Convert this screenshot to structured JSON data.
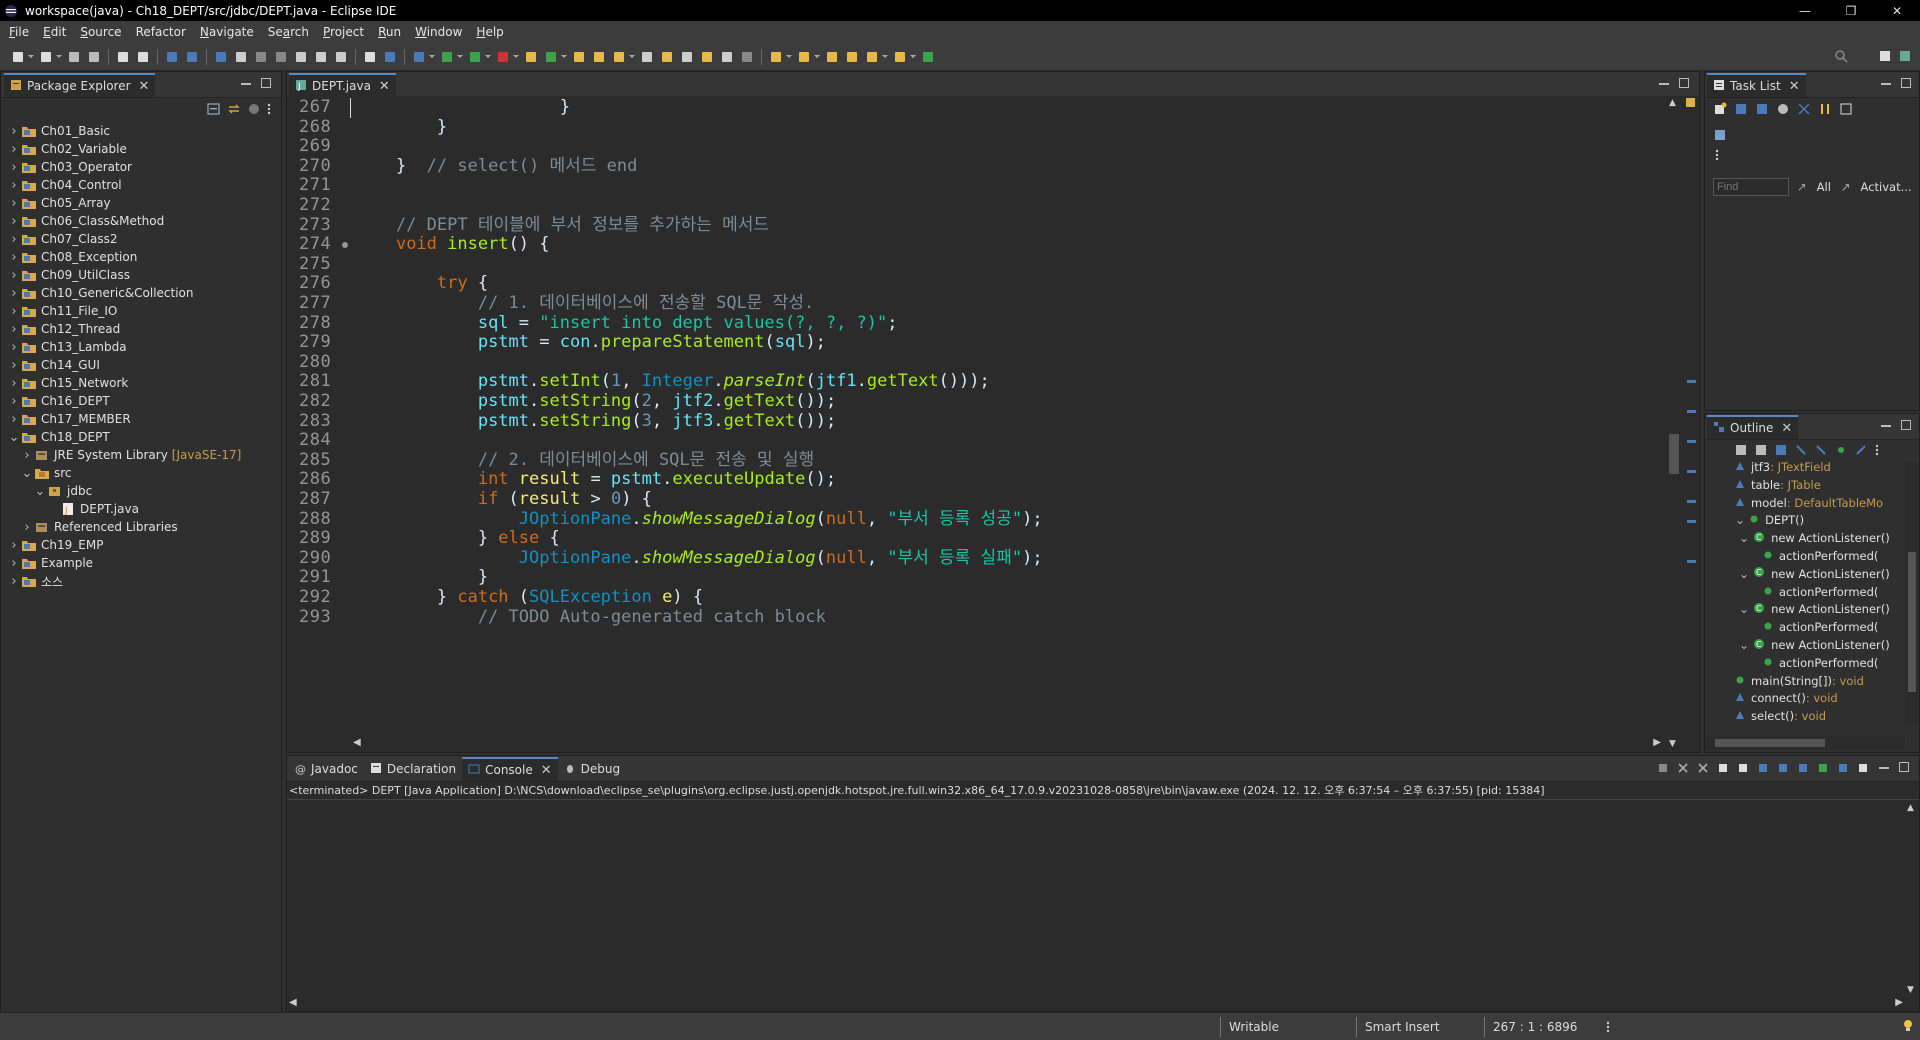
{
  "window": {
    "title": "workspace(java) - Ch18_DEPT/src/jdbc/DEPT.java - Eclipse IDE"
  },
  "menu": [
    "File",
    "Edit",
    "Source",
    "Refactor",
    "Navigate",
    "Search",
    "Project",
    "Run",
    "Window",
    "Help"
  ],
  "menu_mnemonic": [
    "F",
    "E",
    "S",
    "",
    "N",
    "a",
    "P",
    "R",
    "W",
    "H"
  ],
  "package_explorer": {
    "title": "Package Explorer",
    "items": [
      {
        "label": "Ch01_Basic",
        "level": 0,
        "expanded": false,
        "kind": "project"
      },
      {
        "label": "Ch02_Variable",
        "level": 0,
        "expanded": false,
        "kind": "project"
      },
      {
        "label": "Ch03_Operator",
        "level": 0,
        "expanded": false,
        "kind": "project"
      },
      {
        "label": "Ch04_Control",
        "level": 0,
        "expanded": false,
        "kind": "project"
      },
      {
        "label": "Ch05_Array",
        "level": 0,
        "expanded": false,
        "kind": "project"
      },
      {
        "label": "Ch06_Class&Method",
        "level": 0,
        "expanded": false,
        "kind": "project"
      },
      {
        "label": "Ch07_Class2",
        "level": 0,
        "expanded": false,
        "kind": "project"
      },
      {
        "label": "Ch08_Exception",
        "level": 0,
        "expanded": false,
        "kind": "project"
      },
      {
        "label": "Ch09_UtilClass",
        "level": 0,
        "expanded": false,
        "kind": "project"
      },
      {
        "label": "Ch10_Generic&Collection",
        "level": 0,
        "expanded": false,
        "kind": "project"
      },
      {
        "label": "Ch11_File_IO",
        "level": 0,
        "expanded": false,
        "kind": "project"
      },
      {
        "label": "Ch12_Thread",
        "level": 0,
        "expanded": false,
        "kind": "project"
      },
      {
        "label": "Ch13_Lambda",
        "level": 0,
        "expanded": false,
        "kind": "project"
      },
      {
        "label": "Ch14_GUI",
        "level": 0,
        "expanded": false,
        "kind": "project"
      },
      {
        "label": "Ch15_Network",
        "level": 0,
        "expanded": false,
        "kind": "project"
      },
      {
        "label": "Ch16_DEPT",
        "level": 0,
        "expanded": false,
        "kind": "project"
      },
      {
        "label": "Ch17_MEMBER",
        "level": 0,
        "expanded": false,
        "kind": "project"
      },
      {
        "label": "Ch18_DEPT",
        "level": 0,
        "expanded": true,
        "kind": "project"
      },
      {
        "label": "JRE System Library",
        "decoration": "[JavaSE-17]",
        "level": 1,
        "expanded": false,
        "kind": "library"
      },
      {
        "label": "src",
        "level": 1,
        "expanded": true,
        "kind": "srcfolder"
      },
      {
        "label": "jdbc",
        "level": 2,
        "expanded": true,
        "kind": "package"
      },
      {
        "label": "DEPT.java",
        "level": 3,
        "expanded": false,
        "kind": "javafile"
      },
      {
        "label": "Referenced Libraries",
        "level": 1,
        "expanded": false,
        "kind": "library"
      },
      {
        "label": "Ch19_EMP",
        "level": 0,
        "expanded": false,
        "kind": "project"
      },
      {
        "label": "Example",
        "level": 0,
        "expanded": false,
        "kind": "project"
      },
      {
        "label": "소스",
        "level": 0,
        "expanded": false,
        "kind": "project"
      }
    ]
  },
  "editor": {
    "tab": "DEPT.java",
    "lines": [
      {
        "n": "267",
        "code": [
          [
            "pl",
            "                    }"
          ]
        ]
      },
      {
        "n": "268",
        "code": [
          [
            "pl",
            "        }"
          ]
        ]
      },
      {
        "n": "269",
        "code": [
          [
            "pl",
            ""
          ]
        ]
      },
      {
        "n": "270",
        "code": [
          [
            "pl",
            "    }  "
          ],
          [
            "cm",
            "// select() 메서드 end"
          ]
        ]
      },
      {
        "n": "271",
        "code": [
          [
            "pl",
            ""
          ]
        ]
      },
      {
        "n": "272",
        "code": [
          [
            "pl",
            ""
          ]
        ]
      },
      {
        "n": "273",
        "code": [
          [
            "pl",
            "    "
          ],
          [
            "cm",
            "// DEPT 테이블에 부서 정보를 추가하는 메서드"
          ]
        ]
      },
      {
        "n": "274",
        "code": [
          [
            "pl",
            "    "
          ],
          [
            "kw",
            "void "
          ],
          [
            "mt",
            "insert"
          ],
          [
            "pl",
            "() {"
          ]
        ]
      },
      {
        "n": "275",
        "code": [
          [
            "pl",
            ""
          ]
        ]
      },
      {
        "n": "276",
        "code": [
          [
            "pl",
            "        "
          ],
          [
            "kw",
            "try "
          ],
          [
            "pl",
            "{"
          ]
        ]
      },
      {
        "n": "277",
        "code": [
          [
            "pl",
            "            "
          ],
          [
            "cm",
            "// 1. 데이터베이스에 전송할 SQL문 작성."
          ]
        ]
      },
      {
        "n": "278",
        "code": [
          [
            "pl",
            "            "
          ],
          [
            "vr",
            "sql "
          ],
          [
            "pl",
            "= "
          ],
          [
            "st",
            "\"insert into dept values(?, ?, ?)\""
          ],
          [
            "pl",
            ";"
          ]
        ]
      },
      {
        "n": "279",
        "code": [
          [
            "pl",
            "            "
          ],
          [
            "vr",
            "pstmt "
          ],
          [
            "pl",
            "= "
          ],
          [
            "vr",
            "con"
          ],
          [
            "pl",
            "."
          ],
          [
            "mt",
            "prepareStatement"
          ],
          [
            "pl",
            "("
          ],
          [
            "vr",
            "sql"
          ],
          [
            "pl",
            ");"
          ]
        ]
      },
      {
        "n": "280",
        "code": [
          [
            "pl",
            ""
          ]
        ]
      },
      {
        "n": "281",
        "code": [
          [
            "pl",
            "            "
          ],
          [
            "vr",
            "pstmt"
          ],
          [
            "pl",
            "."
          ],
          [
            "mt",
            "setInt"
          ],
          [
            "pl",
            "("
          ],
          [
            "nm",
            "1"
          ],
          [
            "pl",
            ", "
          ],
          [
            "cl",
            "Integer"
          ],
          [
            "pl",
            "."
          ],
          [
            "it",
            "parseInt"
          ],
          [
            "pl",
            "("
          ],
          [
            "vr",
            "jtf1"
          ],
          [
            "pl",
            "."
          ],
          [
            "mt",
            "getText"
          ],
          [
            "pl",
            "()));"
          ]
        ]
      },
      {
        "n": "282",
        "code": [
          [
            "pl",
            "            "
          ],
          [
            "vr",
            "pstmt"
          ],
          [
            "pl",
            "."
          ],
          [
            "mt",
            "setString"
          ],
          [
            "pl",
            "("
          ],
          [
            "nm",
            "2"
          ],
          [
            "pl",
            ", "
          ],
          [
            "vr",
            "jtf2"
          ],
          [
            "pl",
            "."
          ],
          [
            "mt",
            "getText"
          ],
          [
            "pl",
            "());"
          ]
        ]
      },
      {
        "n": "283",
        "code": [
          [
            "pl",
            "            "
          ],
          [
            "vr",
            "pstmt"
          ],
          [
            "pl",
            "."
          ],
          [
            "mt",
            "setString"
          ],
          [
            "pl",
            "("
          ],
          [
            "nm",
            "3"
          ],
          [
            "pl",
            ", "
          ],
          [
            "vr",
            "jtf3"
          ],
          [
            "pl",
            "."
          ],
          [
            "mt",
            "getText"
          ],
          [
            "pl",
            "());"
          ]
        ]
      },
      {
        "n": "284",
        "code": [
          [
            "pl",
            ""
          ]
        ]
      },
      {
        "n": "285",
        "code": [
          [
            "pl",
            "            "
          ],
          [
            "cm",
            "// 2. 데이터베이스에 SQL문 전송 및 실행"
          ]
        ]
      },
      {
        "n": "286",
        "code": [
          [
            "pl",
            "            "
          ],
          [
            "kw",
            "int "
          ],
          [
            "ov",
            "result "
          ],
          [
            "pl",
            "= "
          ],
          [
            "vr",
            "pstmt"
          ],
          [
            "pl",
            "."
          ],
          [
            "mt",
            "executeUpdate"
          ],
          [
            "pl",
            "();"
          ]
        ]
      },
      {
        "n": "287",
        "code": [
          [
            "pl",
            "            "
          ],
          [
            "kw",
            "if "
          ],
          [
            "pl",
            "("
          ],
          [
            "ov",
            "result "
          ],
          [
            "pl",
            "> "
          ],
          [
            "nm",
            "0"
          ],
          [
            "pl",
            ") {"
          ]
        ]
      },
      {
        "n": "288",
        "code": [
          [
            "pl",
            "                "
          ],
          [
            "cl",
            "JOptionPane"
          ],
          [
            "pl",
            "."
          ],
          [
            "it",
            "showMessageDialog"
          ],
          [
            "pl",
            "("
          ],
          [
            "kw",
            "null"
          ],
          [
            "pl",
            ", "
          ],
          [
            "st",
            "\"부서 등록 성공\""
          ],
          [
            "pl",
            ");"
          ]
        ]
      },
      {
        "n": "289",
        "code": [
          [
            "pl",
            "            } "
          ],
          [
            "kw",
            "else "
          ],
          [
            "pl",
            "{"
          ]
        ]
      },
      {
        "n": "290",
        "code": [
          [
            "pl",
            "                "
          ],
          [
            "cl",
            "JOptionPane"
          ],
          [
            "pl",
            "."
          ],
          [
            "it",
            "showMessageDialog"
          ],
          [
            "pl",
            "("
          ],
          [
            "kw",
            "null"
          ],
          [
            "pl",
            ", "
          ],
          [
            "st",
            "\"부서 등록 실패\""
          ],
          [
            "pl",
            ");"
          ]
        ]
      },
      {
        "n": "291",
        "code": [
          [
            "pl",
            "            }"
          ]
        ]
      },
      {
        "n": "292",
        "code": [
          [
            "pl",
            "        } "
          ],
          [
            "kw",
            "catch "
          ],
          [
            "pl",
            "("
          ],
          [
            "cl",
            "SQLException "
          ],
          [
            "ov",
            "e"
          ],
          [
            "pl",
            ") {"
          ]
        ]
      },
      {
        "n": "293",
        "code": [
          [
            "pl",
            "            "
          ],
          [
            "cm",
            "// TODO Auto-generated catch block"
          ]
        ]
      }
    ]
  },
  "task_list": {
    "title": "Task List",
    "find_placeholder": "Find",
    "all": "All",
    "activate": "Activat..."
  },
  "outline": {
    "title": "Outline",
    "items": [
      {
        "label": "jtf3",
        "type": " : JTextField",
        "level": 1
      },
      {
        "label": "table",
        "type": " : JTable",
        "level": 1
      },
      {
        "label": "model",
        "type": " : DefaultTableMo",
        "level": 1
      },
      {
        "label": "DEPT()",
        "type": "",
        "level": 1,
        "expanded": true
      },
      {
        "label": "new ActionListener()",
        "type": "",
        "level": 2,
        "expanded": true
      },
      {
        "label": "actionPerformed(",
        "type": "",
        "level": 3
      },
      {
        "label": "new ActionListener()",
        "type": "",
        "level": 2,
        "expanded": true
      },
      {
        "label": "actionPerformed(",
        "type": "",
        "level": 3
      },
      {
        "label": "new ActionListener()",
        "type": "",
        "level": 2,
        "expanded": true
      },
      {
        "label": "actionPerformed(",
        "type": "",
        "level": 3
      },
      {
        "label": "new ActionListener()",
        "type": "",
        "level": 2,
        "expanded": true
      },
      {
        "label": "actionPerformed(",
        "type": "",
        "level": 3
      },
      {
        "label": "main(String[])",
        "type": " : void",
        "level": 1
      },
      {
        "label": "connect()",
        "type": " : void",
        "level": 1
      },
      {
        "label": "select()",
        "type": " : void",
        "level": 1
      }
    ]
  },
  "bottom_tabs": {
    "javadoc": "Javadoc",
    "declaration": "Declaration",
    "console": "Console",
    "debug": "Debug"
  },
  "console": {
    "status": "<terminated> DEPT [Java Application] D:\\NCS\\download\\eclipse_se\\plugins\\org.eclipse.justj.openjdk.hotspot.jre.full.win32.x86_64_17.0.9.v20231028-0858\\jre\\bin\\javaw.exe  (2024. 12. 12. 오후 6:37:54 – 오후 6:37:55) [pid: 15384]"
  },
  "status": {
    "writable": "Writable",
    "insert_mode": "Smart Insert",
    "position": "267 : 1 : 6896"
  },
  "colors": {
    "accent": "#5a87c4",
    "background": "#2f2f2f",
    "editor_bg": "#2b2b2b"
  }
}
